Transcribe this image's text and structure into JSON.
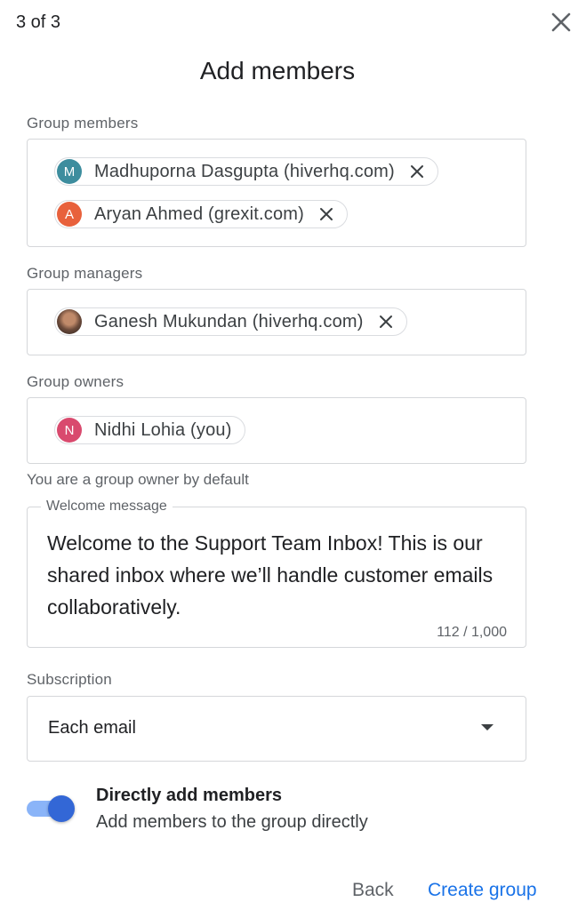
{
  "header": {
    "step": "3 of 3",
    "title": "Add members"
  },
  "group_members": {
    "label": "Group members",
    "chips": [
      {
        "initial": "M",
        "name": "Madhuporna Dasgupta (hiverhq.com)",
        "color": "#3d8d9e"
      },
      {
        "initial": "A",
        "name": "Aryan Ahmed (grexit.com)",
        "color": "#e8613c"
      }
    ]
  },
  "group_managers": {
    "label": "Group managers",
    "chips": [
      {
        "name": "Ganesh Mukundan (hiverhq.com)"
      }
    ]
  },
  "group_owners": {
    "label": "Group owners",
    "chips": [
      {
        "initial": "N",
        "name": "Nidhi Lohia (you)",
        "color": "#d94a6e"
      }
    ],
    "helper": "You are a group owner by default"
  },
  "welcome": {
    "label": "Welcome message",
    "text": "Welcome to the Support Team Inbox! This is our shared inbox where we’ll handle customer emails collaboratively.",
    "counter": "112 / 1,000"
  },
  "subscription": {
    "label": "Subscription",
    "value": "Each email"
  },
  "direct_add": {
    "title": "Directly add members",
    "description": "Add members to the group directly",
    "enabled": true
  },
  "actions": {
    "back": "Back",
    "create": "Create group"
  },
  "colors": {
    "accent": "#1a73e8",
    "toggle_thumb": "#3367d6",
    "toggle_track": "#8ab4f8"
  }
}
